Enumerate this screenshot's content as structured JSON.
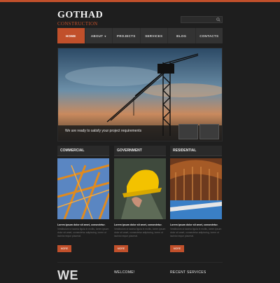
{
  "brand": {
    "name": "GOTHAD",
    "tagline": "CONSTRUCTION"
  },
  "nav": {
    "items": [
      {
        "label": "HOME",
        "active": true
      },
      {
        "label": "ABOUT",
        "has_dropdown": true
      },
      {
        "label": "PROJECTS"
      },
      {
        "label": "SERVICES"
      },
      {
        "label": "BLOG"
      },
      {
        "label": "CONTACTS"
      }
    ]
  },
  "hero": {
    "caption": "We are ready to satisfy your project requirements"
  },
  "columns": [
    {
      "title": "COMMERCIAL",
      "lead": "Lorem ipsum dolor sit amet, consectetur.",
      "body": "Vestibulum ut lacinia ligula in mollis, lorem ipsum dolor sit amet, consectetur adipiscing, lorem ut lacinia neque placerat.",
      "button": "MORE"
    },
    {
      "title": "GOVERNMENT",
      "lead": "Lorem ipsum dolor sit amet, consectetur.",
      "body": "Vestibulum ut lacinia ligula in mollis, lorem ipsum dolor sit amet, consectetur adipiscing, lorem ut lacinia neque placerat.",
      "button": "MORE"
    },
    {
      "title": "RESIDENTIAL",
      "lead": "Lorem ipsum dolor sit amet, consectetur.",
      "body": "Vestibulum ut lacinia ligula in mollis, lorem ipsum dolor sit amet, consectetur adipiscing, lorem ut lacinia neque placerat.",
      "button": "MORE"
    }
  ],
  "bottom": {
    "we": "WE",
    "welcome": "WELCOME!",
    "recent": "RECENT SERVICES"
  },
  "colors": {
    "accent": "#c1502b",
    "background": "#1e1e1e",
    "nav": "#333333"
  },
  "icons": {
    "search": "search-icon",
    "dropdown": "chevron-down-icon"
  }
}
